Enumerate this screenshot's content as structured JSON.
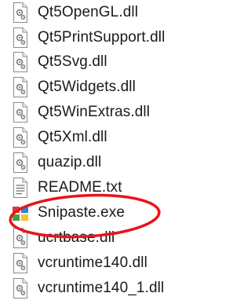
{
  "files": [
    {
      "name": "Qt5OpenGL.dll",
      "icon": "dll-file-icon"
    },
    {
      "name": "Qt5PrintSupport.dll",
      "icon": "dll-file-icon"
    },
    {
      "name": "Qt5Svg.dll",
      "icon": "dll-file-icon"
    },
    {
      "name": "Qt5Widgets.dll",
      "icon": "dll-file-icon"
    },
    {
      "name": "Qt5WinExtras.dll",
      "icon": "dll-file-icon"
    },
    {
      "name": "Qt5Xml.dll",
      "icon": "dll-file-icon"
    },
    {
      "name": "quazip.dll",
      "icon": "dll-file-icon"
    },
    {
      "name": "README.txt",
      "icon": "text-file-icon"
    },
    {
      "name": "Snipaste.exe",
      "icon": "snipaste-app-icon"
    },
    {
      "name": "ucrtbase.dll",
      "icon": "dll-file-icon"
    },
    {
      "name": "vcruntime140.dll",
      "icon": "dll-file-icon"
    },
    {
      "name": "vcruntime140_1.dll",
      "icon": "dll-file-icon"
    }
  ],
  "annotation": {
    "color": "#e8141c"
  }
}
